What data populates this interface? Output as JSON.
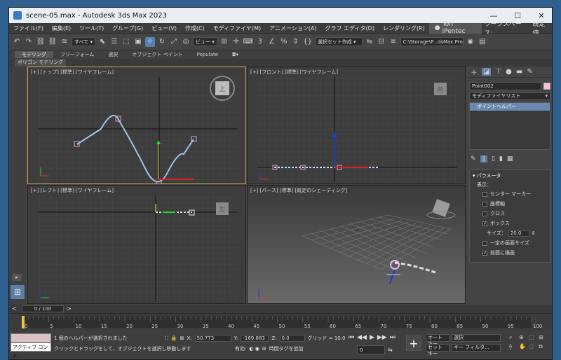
{
  "window": {
    "title": "scene-05.max - Autodesk 3ds Max 2023"
  },
  "menu": {
    "items": [
      "ファイル(F)",
      "編集(E)",
      "ツール(T)",
      "グループ(G)",
      "ビュー(V)",
      "作成(C)",
      "モディファイヤ(M)",
      "アニメーション(A)",
      "グラフ エディタ(D)",
      "レンダリング(R)"
    ],
    "user": "Tori iPentec",
    "workspace_label": "ワークスペース:",
    "workspace_value": "既定値"
  },
  "toolbar": {
    "filter": "すべて",
    "refcoord": "ビュー",
    "selection_set": "選択セット作成",
    "project_path": "C:\\Storage\\P...dsMax Project"
  },
  "ribbon": {
    "tabs": [
      "モデリング",
      "フリーフォーム",
      "選択",
      "オブジェクト ペイント",
      "Populate"
    ],
    "sub": "ポリゴン モデリング"
  },
  "viewports": {
    "top": "[+] [トップ] [標準] [ワイヤフレーム]",
    "front": "[+] [フロント] [標準] [ワイヤフレーム]",
    "left": "[+] [レフト] [標準] [ワイヤフレーム]",
    "persp": "[+] [パース] [標準] [既定のシェーディング]",
    "cube_top": "上",
    "cube_front": "前",
    "cube_left": "左"
  },
  "command_panel": {
    "object_name": "Point002",
    "modifier_list": "モディファイヤリスト",
    "stack_item": "ポイントヘルパー",
    "params_title": "パラメータ",
    "display_label": "表示：",
    "options": [
      {
        "label": "センター マーカー",
        "checked": false
      },
      {
        "label": "座標軸",
        "checked": false
      },
      {
        "label": "クロス",
        "checked": false
      },
      {
        "label": "ボックス",
        "checked": true
      }
    ],
    "size_label": "サイズ：",
    "size_value": "20.0",
    "constant_size": {
      "label": "一定の画面サイズ",
      "checked": false
    },
    "draw_on_top": {
      "label": "前面に描画",
      "checked": true
    }
  },
  "timeline": {
    "frame_display": "0 / 100",
    "ticks": [
      "0",
      "5",
      "10",
      "15",
      "20",
      "25",
      "30",
      "35",
      "40",
      "45",
      "50",
      "55",
      "60",
      "65",
      "70",
      "75",
      "80",
      "85",
      "90",
      "95",
      "100"
    ]
  },
  "status": {
    "command_line": "アクティブ コンド",
    "message1": "1 個のヘルパーが選択されました",
    "message2": "クリックとドラッグをして、オブジェクトを選択し移動します",
    "x_label": "X:",
    "x_value": "50.773",
    "y_label": "Y:",
    "y_value": "-169.883",
    "z_label": "Z:",
    "z_value": "0.0",
    "grid": "グリッド = 10.0",
    "enabled": "有効:",
    "add_time_tag": "時間タグを追加",
    "frame": "0",
    "auto_key": "オート キー",
    "set_key": "セット キー",
    "selected": "選択",
    "key_filter": "キー フィルタ..."
  }
}
